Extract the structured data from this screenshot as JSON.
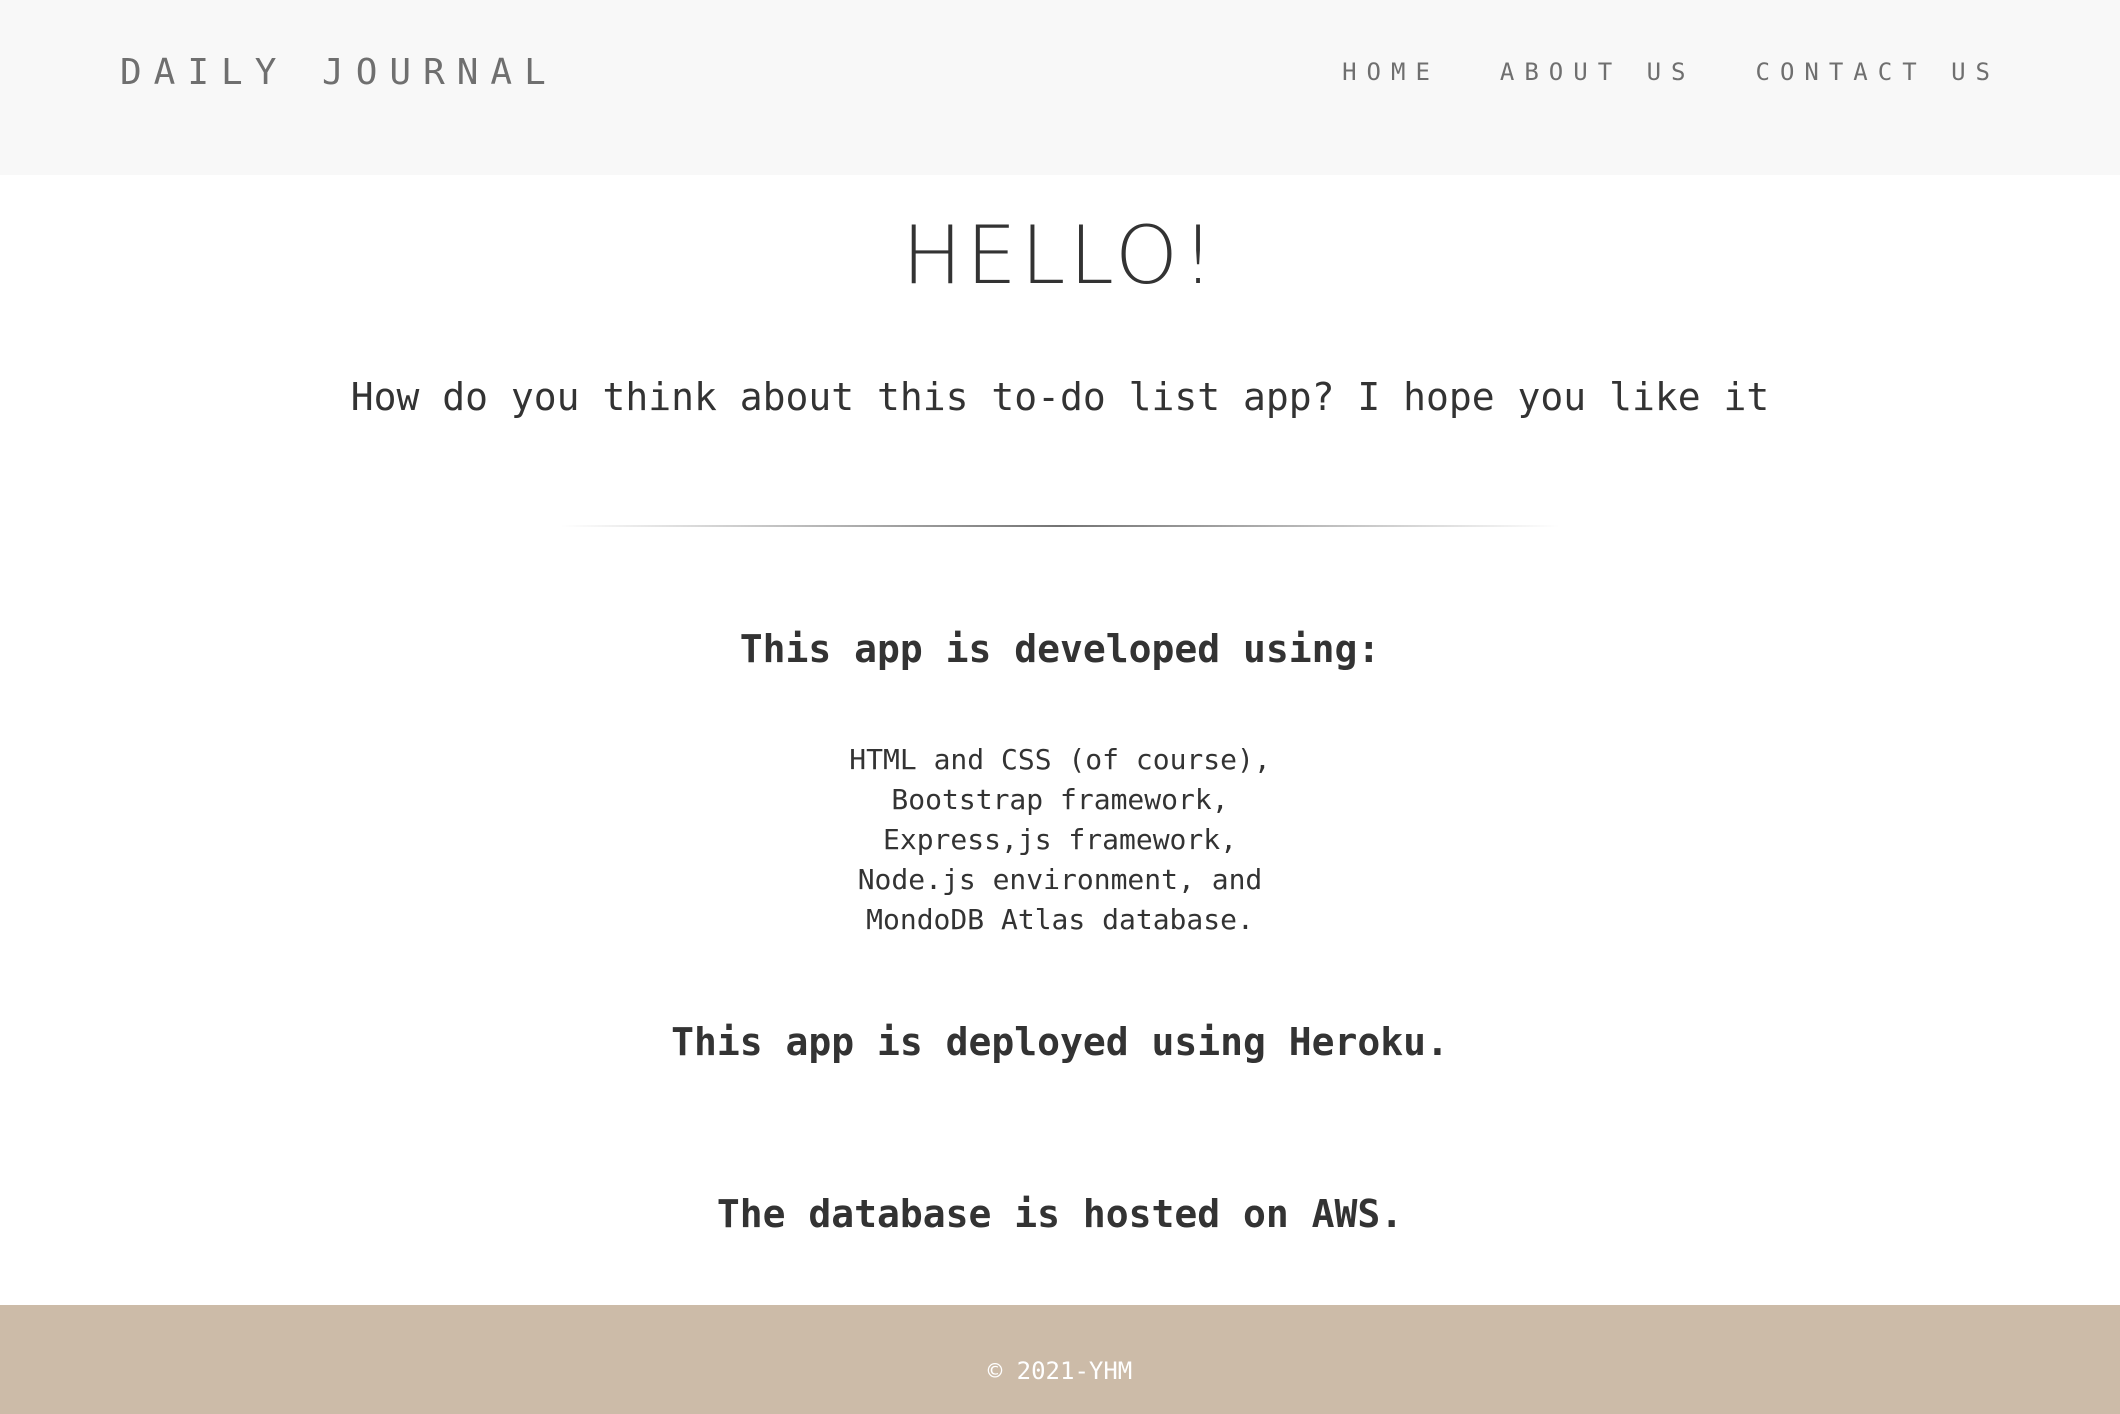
{
  "navbar": {
    "brand": "DAILY JOURNAL",
    "links": [
      {
        "label": "HOME"
      },
      {
        "label": "ABOUT US"
      },
      {
        "label": "CONTACT US"
      }
    ]
  },
  "main": {
    "title": "HELLO!",
    "intro": "How do you think about this to-do list app? I hope you like it",
    "developed_heading": "This app is developed using:",
    "tech_list": [
      "HTML and CSS (of course),",
      "Bootstrap framework,",
      "Express,js framework,",
      "Node.js environment, and",
      "MondoDB Atlas database."
    ],
    "deployed_text": "This app is deployed using Heroku.",
    "database_text": "The database is hosted on AWS."
  },
  "footer": {
    "copyright": "© 2021-YHM"
  },
  "colors": {
    "navbar_bg": "#f8f8f8",
    "footer_bg": "#ccbba8",
    "nav_text": "#6f6f6f",
    "body_text": "#333333"
  }
}
